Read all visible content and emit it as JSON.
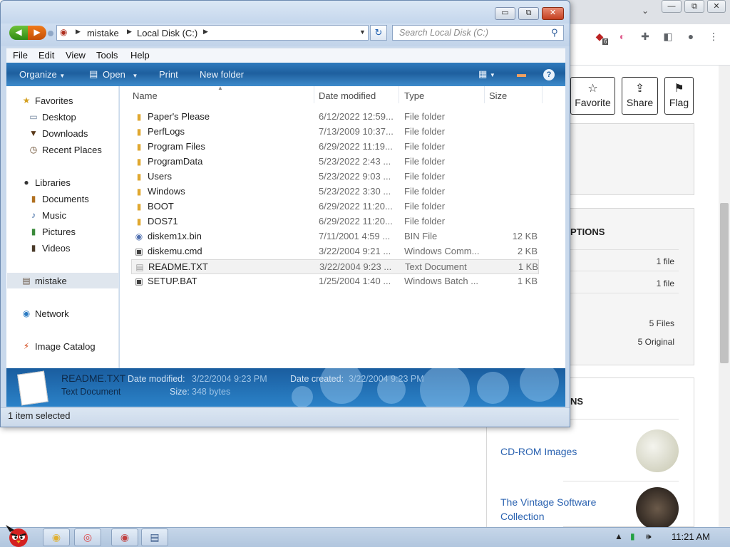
{
  "explorer": {
    "window_controls": {
      "minimize": "▭",
      "maximize": "⧉",
      "close": "✕"
    },
    "address": {
      "crumbs": [
        "mistake",
        "Local Disk (C:)"
      ]
    },
    "search": {
      "placeholder": "Search Local Disk (C:)"
    },
    "menu": [
      "File",
      "Edit",
      "View",
      "Tools",
      "Help"
    ],
    "commands": {
      "organize": "Organize",
      "open": "Open",
      "print": "Print",
      "new_folder": "New folder"
    },
    "nav": {
      "favorites_header": "Favorites",
      "favorites": [
        "Desktop",
        "Downloads",
        "Recent Places"
      ],
      "libraries_header": "Libraries",
      "libraries": [
        "Documents",
        "Music",
        "Pictures",
        "Videos"
      ],
      "computer": "mistake",
      "network": "Network",
      "image_catalog": "Image Catalog"
    },
    "columns": [
      "Name",
      "Date modified",
      "Type",
      "Size"
    ],
    "files": [
      {
        "name": "Paper's Please",
        "date": "6/12/2022 12:59...",
        "type": "File folder",
        "size": "",
        "icon": "folder-icon"
      },
      {
        "name": "PerfLogs",
        "date": "7/13/2009 10:37...",
        "type": "File folder",
        "size": "",
        "icon": "folder-icon"
      },
      {
        "name": "Program Files",
        "date": "6/29/2022 11:19...",
        "type": "File folder",
        "size": "",
        "icon": "folder-icon"
      },
      {
        "name": "ProgramData",
        "date": "5/23/2022 2:43 ...",
        "type": "File folder",
        "size": "",
        "icon": "folder-icon"
      },
      {
        "name": "Users",
        "date": "5/23/2022 9:03 ...",
        "type": "File folder",
        "size": "",
        "icon": "folder-icon"
      },
      {
        "name": "Windows",
        "date": "5/23/2022 3:30 ...",
        "type": "File folder",
        "size": "",
        "icon": "folder-icon"
      },
      {
        "name": "BOOT",
        "date": "6/29/2022 11:20...",
        "type": "File folder",
        "size": "",
        "icon": "folder-icon"
      },
      {
        "name": "DOS71",
        "date": "6/29/2022 11:20...",
        "type": "File folder",
        "size": "",
        "icon": "folder-icon"
      },
      {
        "name": "diskem1x.bin",
        "date": "7/11/2001 4:59 ...",
        "type": "BIN File",
        "size": "12 KB",
        "icon": "disc-icon"
      },
      {
        "name": "diskemu.cmd",
        "date": "3/22/2004 9:21 ...",
        "type": "Windows Comm...",
        "size": "2 KB",
        "icon": "gear-icon"
      },
      {
        "name": "README.TXT",
        "date": "3/22/2004 9:23 ...",
        "type": "Text Document",
        "size": "1 KB",
        "icon": "text-file-icon"
      },
      {
        "name": "SETUP.BAT",
        "date": "1/25/2004 1:40 ...",
        "type": "Windows Batch ...",
        "size": "1 KB",
        "icon": "gear-icon"
      }
    ],
    "selected_index": 10,
    "details": {
      "name": "README.TXT",
      "type": "Text Document",
      "modified_label": "Date modified:",
      "modified_value": "3/22/2004 9:23 PM",
      "created_label": "Date created:",
      "created_value": "3/22/2004 9:23 PM",
      "size_label": "Size:",
      "size_value": "348 bytes"
    },
    "status": "1 item selected"
  },
  "browser": {
    "actions": [
      "Favorite",
      "Share",
      "Flag"
    ],
    "ext_badge": "6",
    "card2_heading": "PTIONS",
    "card2_rows": [
      "1 file",
      "1 file",
      "5 Files",
      "5 Original"
    ],
    "card3_heading": "NS",
    "collections": [
      "CD-ROM Images",
      "The Vintage Software",
      "Collection"
    ]
  },
  "taskbar": {
    "clock": "11:21 AM"
  },
  "colors": {
    "accent": "#2b7ac2",
    "link": "#2a62b0",
    "close": "#c43f20"
  }
}
